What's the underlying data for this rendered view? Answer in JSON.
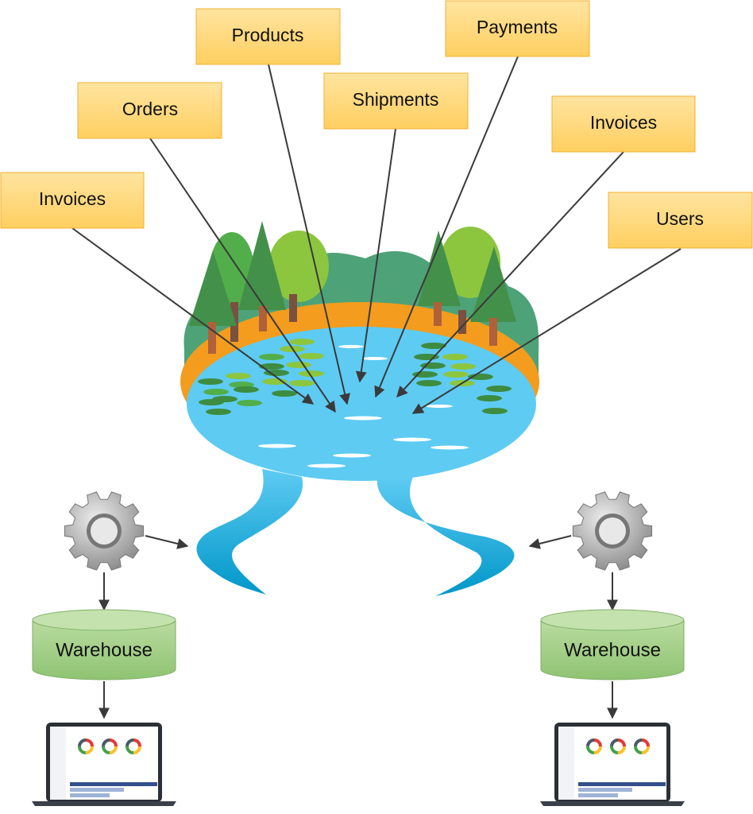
{
  "sources": [
    {
      "label": "Invoices"
    },
    {
      "label": "Orders"
    },
    {
      "label": "Products"
    },
    {
      "label": "Shipments"
    },
    {
      "label": "Payments"
    },
    {
      "label": "Invoices"
    },
    {
      "label": "Users"
    }
  ],
  "central": {
    "icon": "data-lake-icon"
  },
  "pipelines": [
    {
      "process_icon": "gear-icon",
      "store_label": "Warehouse",
      "client_icon": "laptop-dashboard-icon"
    },
    {
      "process_icon": "gear-icon",
      "store_label": "Warehouse",
      "client_icon": "laptop-dashboard-icon"
    }
  ],
  "colors": {
    "source_box": "#ffd67a",
    "source_border": "#f0b030",
    "water": "#5ecbf3",
    "river": "#12b0e0",
    "rim": "#f39c1e",
    "warehouse": "#a9d18e",
    "arrow": "#3a3a3a"
  }
}
